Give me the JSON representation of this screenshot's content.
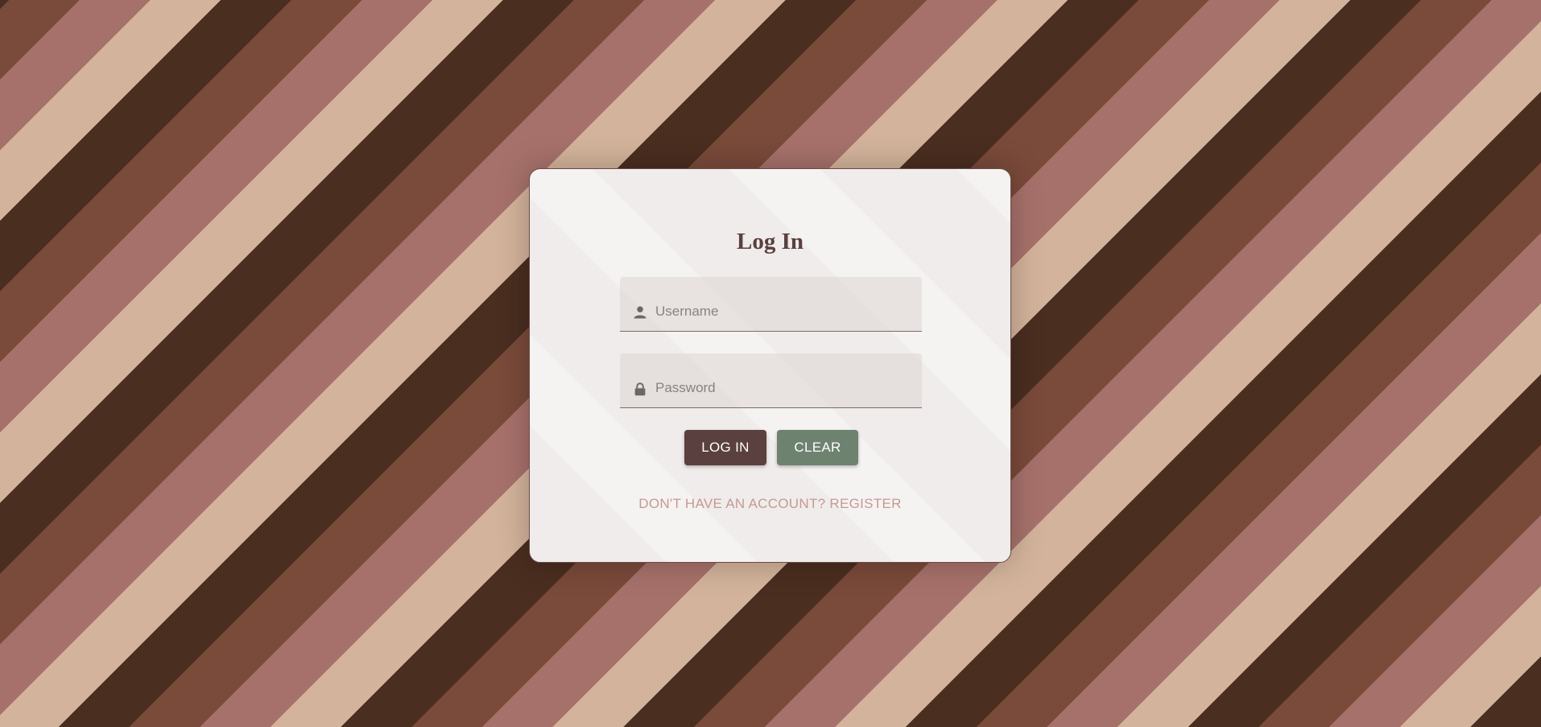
{
  "login_form": {
    "title": "Log In",
    "username": {
      "placeholder": "Username",
      "value": "",
      "icon": "user-icon"
    },
    "password": {
      "placeholder": "Password",
      "value": "",
      "icon": "lock-icon"
    },
    "login_button": "LOG IN",
    "clear_button": "CLEAR",
    "register_link": "DON'T HAVE AN ACCOUNT? REGISTER"
  },
  "colors": {
    "stripes": [
      "#4a2e20",
      "#d3b39b",
      "#a7716b",
      "#7a4a3a"
    ],
    "title": "#5a403e",
    "login_button": "#5a403e",
    "clear_button": "#6d8370",
    "register_link": "#c49a94"
  }
}
